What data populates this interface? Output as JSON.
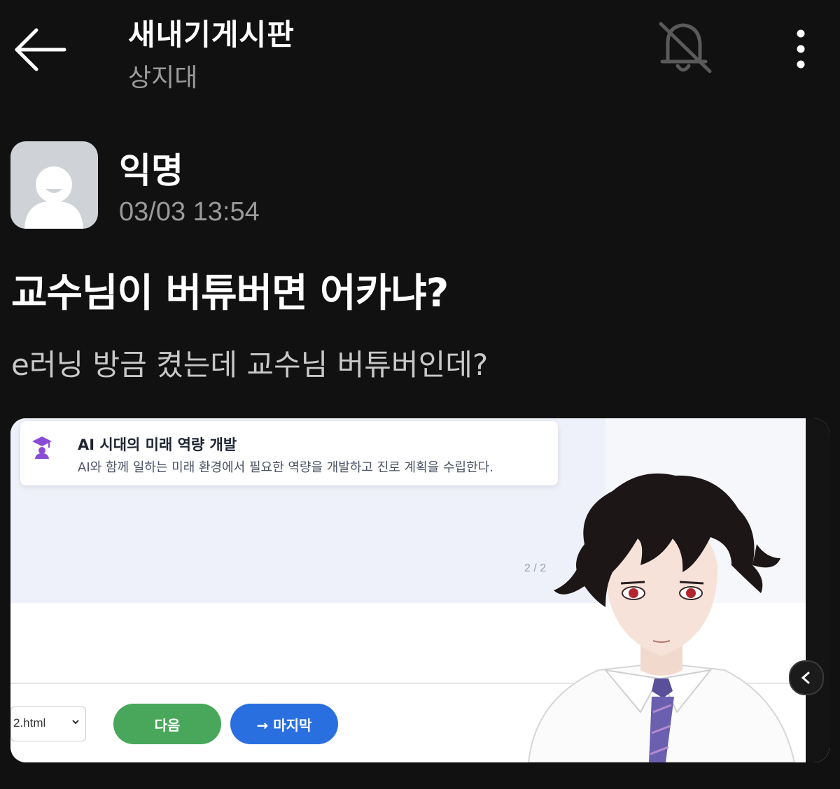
{
  "header": {
    "board_title": "새내기게시판",
    "school": "상지대"
  },
  "post": {
    "author": "익명",
    "time": "03/03 13:54",
    "title": "교수님이 버튜버면 어카냐?",
    "body": "e러닝 방금 켰는데 교수님 버튜버인데?"
  },
  "attachment": {
    "lesson_title": "AI 시대의 미래 역량 개발",
    "lesson_desc": "AI와 함께 일하는 미래 환경에서 필요한 역량을 개발하고 진로 계획을 수립한다.",
    "page_indicator": "2 / 2",
    "file_select_value": "2.html",
    "next_button": "다음",
    "last_button": "→ 마지막"
  },
  "icons": {
    "back": "arrow-left-icon",
    "notification": "bell-off-icon",
    "more": "more-vertical-icon",
    "avatar": "user-placeholder-icon",
    "lesson": "graduation-cap-icon",
    "nav": "chevron-left-icon"
  },
  "colors": {
    "background": "#111111",
    "secondary_text": "#9a9a9a",
    "next_button": "#48a75a",
    "last_button": "#2a6fe0",
    "lesson_icon": "#8a4bd6"
  }
}
